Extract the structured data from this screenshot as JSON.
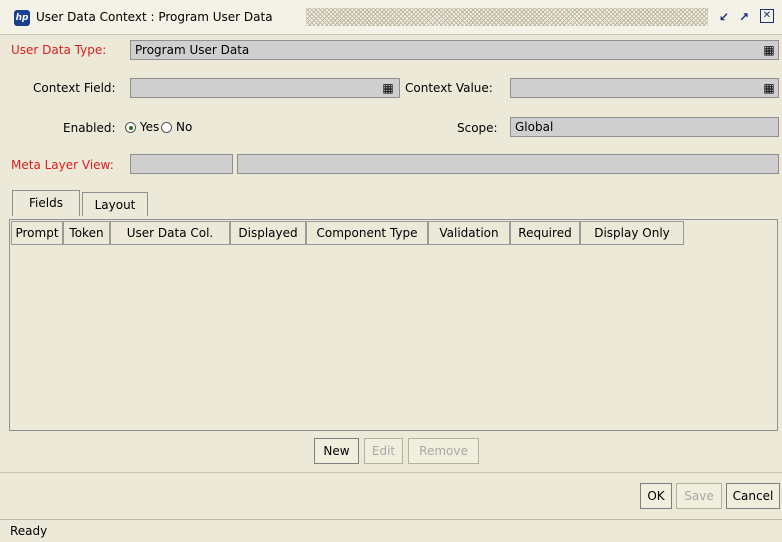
{
  "window": {
    "title": "User Data Context : Program User Data",
    "logo": "hp"
  },
  "form": {
    "user_data_type_label": "User Data Type:",
    "user_data_type_value": "Program User Data",
    "context_field_label": "Context Field:",
    "context_field_value": "",
    "context_value_label": "Context Value:",
    "context_value_value": "",
    "enabled_label": "Enabled:",
    "yes_label": "Yes",
    "no_label": "No",
    "enabled_selected": "Yes",
    "scope_label": "Scope:",
    "scope_value": "Global",
    "meta_layer_view_label": "Meta Layer View:",
    "meta_layer_view_value1": "",
    "meta_layer_view_value2": ""
  },
  "tabs": [
    {
      "label": "Fields",
      "active": true
    },
    {
      "label": "Layout",
      "active": false
    }
  ],
  "table": {
    "columns": [
      "Prompt",
      "Token",
      "User Data Col.",
      "Displayed",
      "Component Type",
      "Validation",
      "Required",
      "Display Only"
    ],
    "rows": []
  },
  "table_buttons": {
    "new": "New",
    "edit": "Edit",
    "remove": "Remove"
  },
  "dialog_buttons": {
    "ok": "OK",
    "save": "Save",
    "cancel": "Cancel"
  },
  "status": "Ready",
  "icons": {
    "picker": "list-picker-icon",
    "restore": "restore-icon",
    "maximize": "maximize-icon",
    "close": "close-icon"
  },
  "colors": {
    "required_label": "#d81f1f",
    "background": "#ece9d8",
    "field_background": "#cfcfcf"
  }
}
